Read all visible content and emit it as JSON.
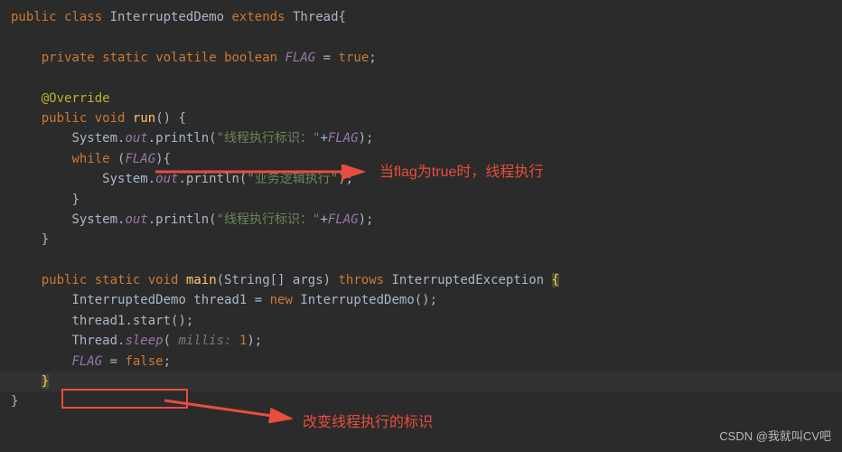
{
  "code": {
    "l1_public": "public",
    "l1_class": "class",
    "l1_classname": "InterruptedDemo",
    "l1_extends": "extends",
    "l1_thread": "Thread",
    "l1_brace": "{",
    "l3_private": "private",
    "l3_static": "static",
    "l3_volatile": "volatile",
    "l3_boolean": "boolean",
    "l3_flag": "FLAG",
    "l3_eq": " = ",
    "l3_true": "true",
    "l3_semi": ";",
    "l5_override": "@Override",
    "l6_public": "public",
    "l6_void": "void",
    "l6_run": "run",
    "l6_paren": "() {",
    "l7_system": "System.",
    "l7_out": "out",
    "l7_println": ".println(",
    "l7_str": "\"线程执行标识：\"",
    "l7_plus": "+",
    "l7_flag": "FLAG",
    "l7_end": ");",
    "l8_while": "while",
    "l8_open": " (",
    "l8_flag": "FLAG",
    "l8_close": "){",
    "l9_system": "System.",
    "l9_out": "out",
    "l9_println": ".println(",
    "l9_str": "\"业务逻辑执行\"",
    "l9_end": ");",
    "l10_close": "}",
    "l11_system": "System.",
    "l11_out": "out",
    "l11_println": ".println(",
    "l11_str": "\"线程执行标识：\"",
    "l11_plus": "+",
    "l11_flag": "FLAG",
    "l11_end": ");",
    "l12_close": "}",
    "l14_public": "public",
    "l14_static": "static",
    "l14_void": "void",
    "l14_main": "main",
    "l14_args": "(String[] args) ",
    "l14_throws": "throws",
    "l14_exc": " InterruptedException ",
    "l14_brace": "{",
    "l15_type": "InterruptedDemo thread1 = ",
    "l15_new": "new",
    "l15_ctor": " InterruptedDemo();",
    "l16_start": "thread1.start();",
    "l17_thread": "Thread.",
    "l17_sleep": "sleep",
    "l17_open": "( ",
    "l17_hint": "millis: ",
    "l17_val": "1",
    "l17_end": ");",
    "l18_flag": "FLAG",
    "l18_eq": " = ",
    "l18_false": "false",
    "l18_semi": ";",
    "l19_close": "}",
    "l20_close": "}"
  },
  "annotations": {
    "text1": "当flag为true时，线程执行",
    "text2": "改变线程执行的标识"
  },
  "watermark": "CSDN @我就叫CV吧"
}
